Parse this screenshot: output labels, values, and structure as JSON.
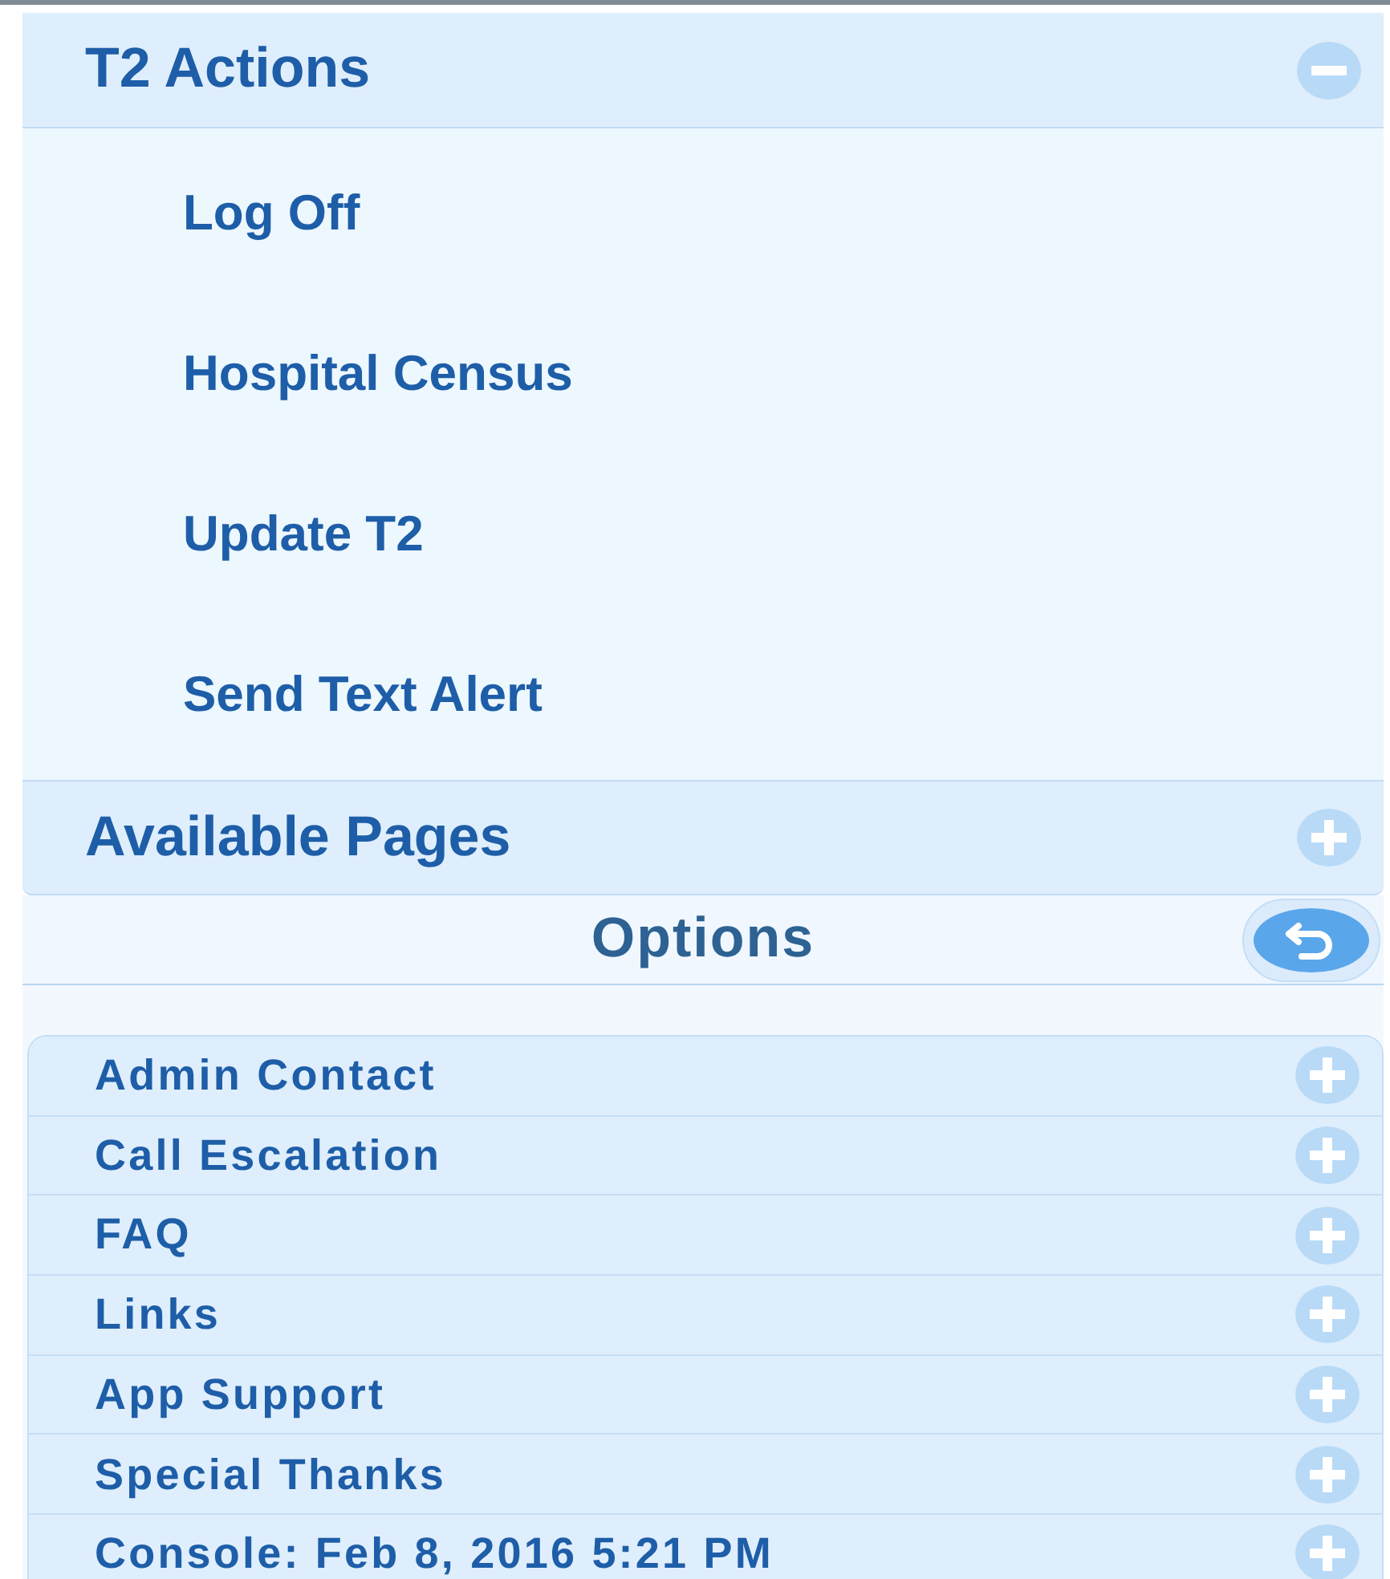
{
  "sections": [
    {
      "title": "T2 Actions",
      "expanded": true,
      "items": [
        "Log Off",
        "Hospital Census",
        "Update T2",
        "Send Text Alert"
      ]
    },
    {
      "title": "Available Pages",
      "expanded": false
    }
  ],
  "options": {
    "title": "Options",
    "items": [
      {
        "label": "Admin Contact",
        "expanded": false
      },
      {
        "label": "Call Escalation",
        "expanded": false
      },
      {
        "label": "FAQ",
        "expanded": false
      },
      {
        "label": "Links",
        "expanded": false
      },
      {
        "label": "App Support",
        "expanded": false
      },
      {
        "label": "Special Thanks",
        "expanded": false
      },
      {
        "label": "Console: Feb 8, 2016 5:21 PM",
        "expanded": false
      }
    ]
  }
}
